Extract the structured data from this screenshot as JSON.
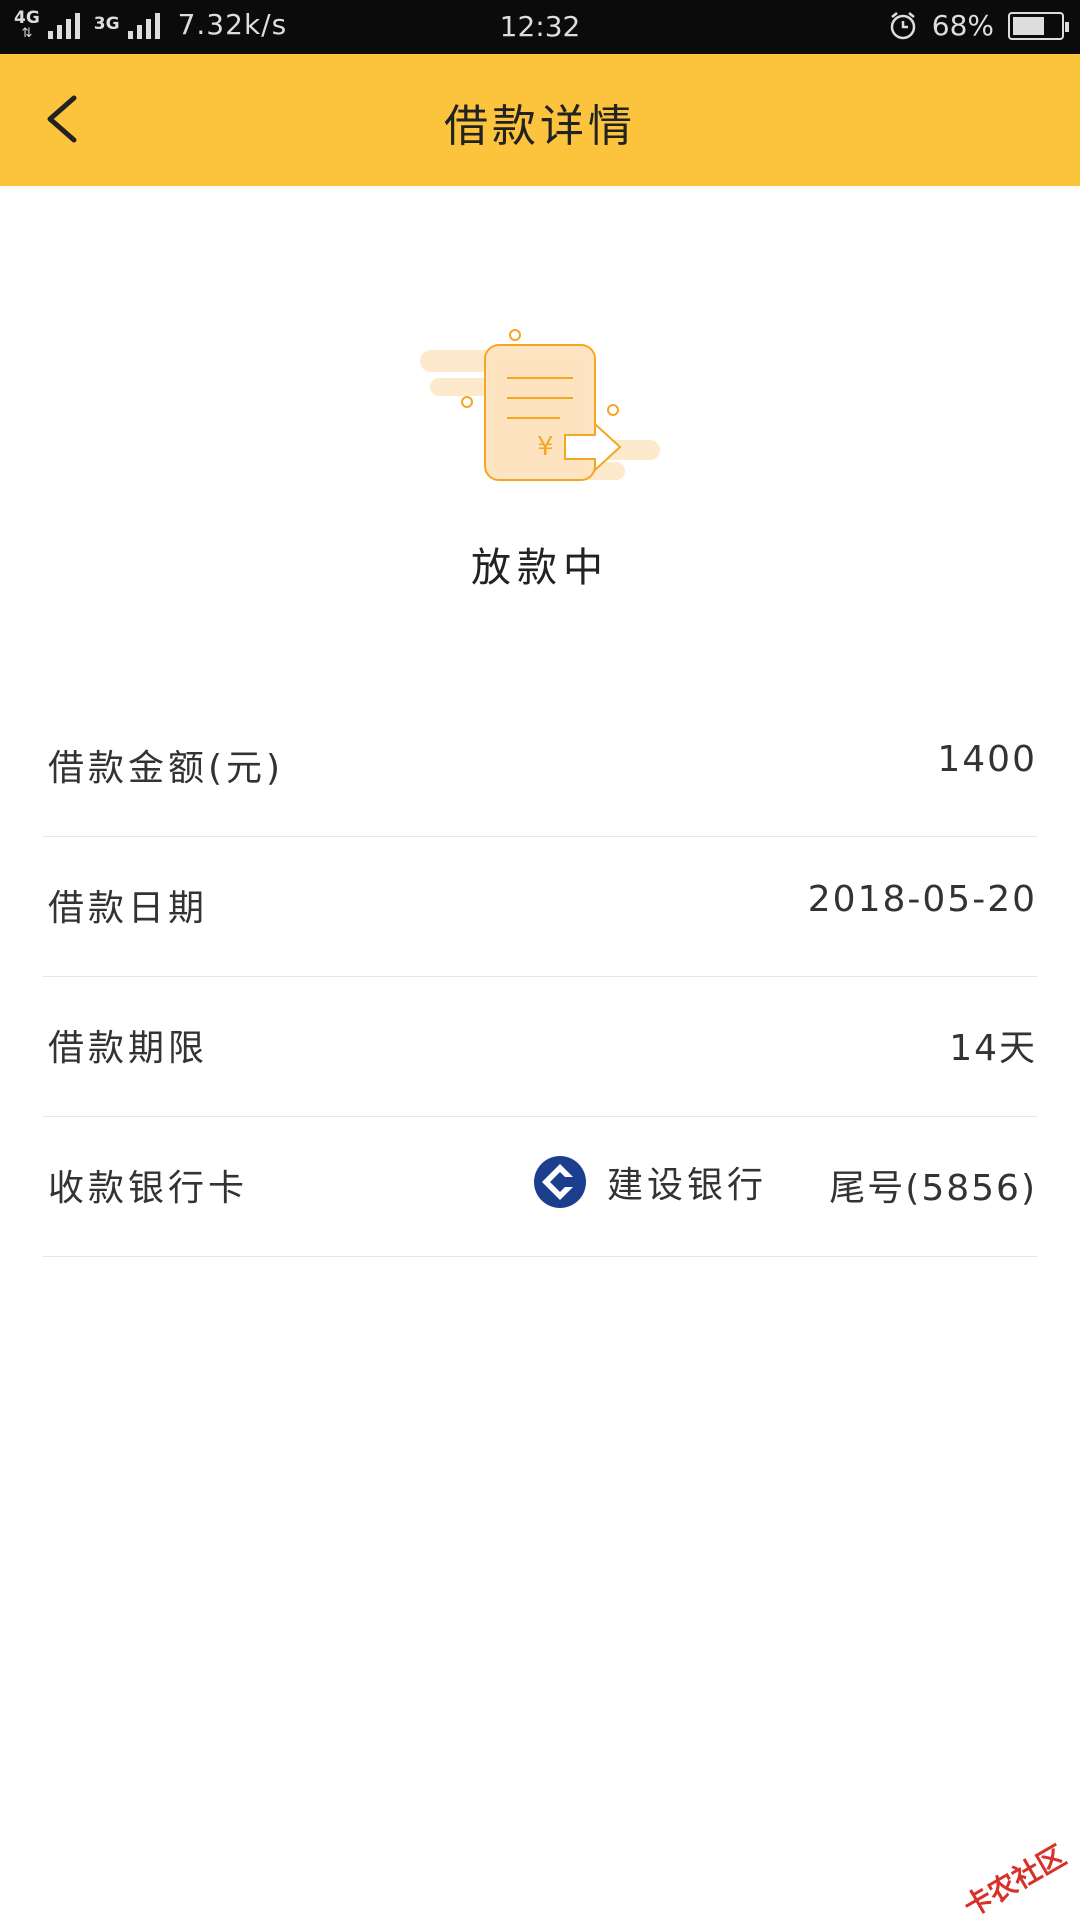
{
  "status_bar": {
    "net1": "4G",
    "net2": "4G",
    "net3": "3G",
    "speed": "7.32k/s",
    "time": "12:32",
    "battery": "68%",
    "battery_level": 0.68
  },
  "header": {
    "title": "借款详情"
  },
  "status": {
    "text": "放款中"
  },
  "details": {
    "amount_label": "借款金额(元)",
    "amount_value": "1400",
    "date_label": "借款日期",
    "date_value": "2018-05-20",
    "term_label": "借款期限",
    "term_value": "14天",
    "card_label": "收款银行卡",
    "bank_name": "建设银行",
    "card_tail": "尾号(5856)"
  },
  "watermark": "卡农社区",
  "colors": {
    "accent": "#fcc33d",
    "icon_orange": "#f5a623",
    "bank_blue": "#1b3e8f"
  }
}
